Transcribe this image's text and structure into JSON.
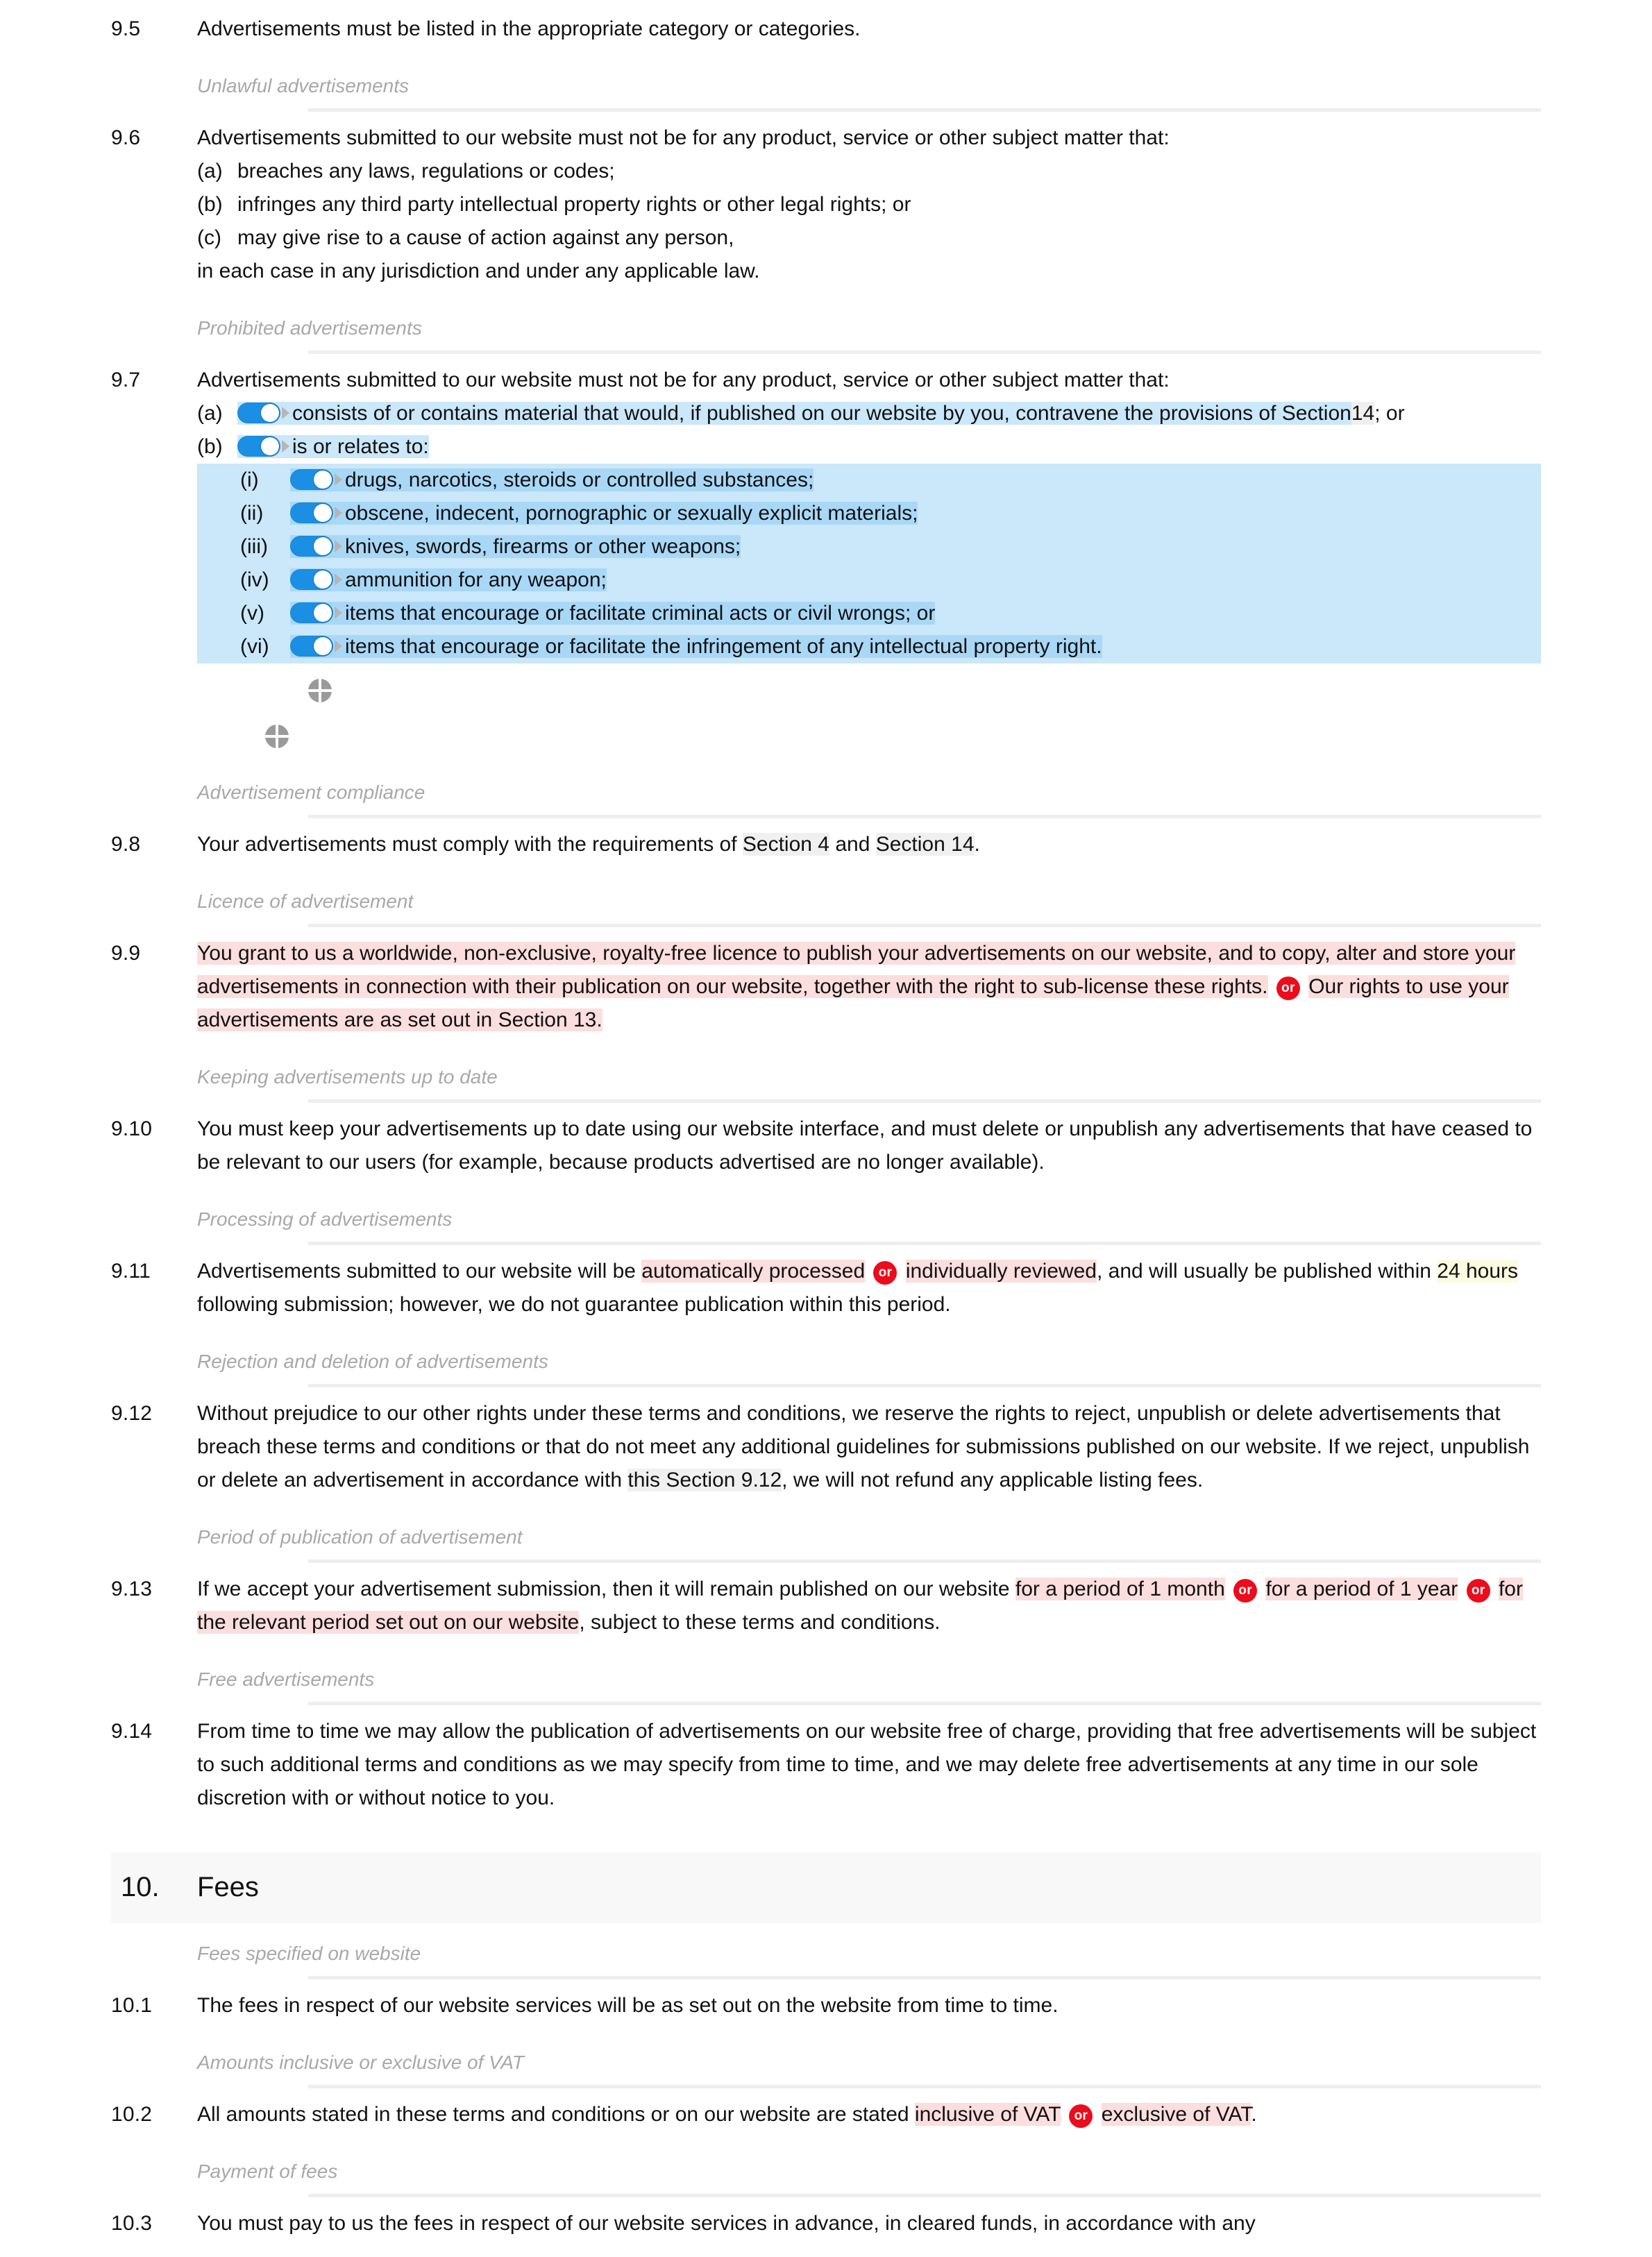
{
  "document": {
    "type": "terms-and-conditions-template-editor",
    "colors": {
      "toggle_on": "#1b8fe3",
      "or_badge": "#ec0c1b",
      "optional_highlight": "#fbdedd",
      "variable_highlight": "#fbfbe0",
      "crossref_highlight": "#f0f0f0",
      "selected_option_highlight": "#cbe7fa",
      "section_heading_band": "#f8f8f8",
      "subheading_text": "#a8a8a8"
    }
  },
  "clauses": [
    {
      "num": "9.5",
      "text": "Advertisements must be listed in the appropriate category or categories."
    }
  ],
  "subheads": {
    "unlawful": "Unlawful advertisements",
    "prohibited": "Prohibited advertisements",
    "compliance": "Advertisement compliance",
    "licence": "Licence of advertisement",
    "keeping": "Keeping advertisements up to date",
    "processing": "Processing of advertisements",
    "rejection": "Rejection and deletion of advertisements",
    "period": "Period of publication of advertisement",
    "free": "Free advertisements",
    "fees_specified": "Fees specified on website",
    "amounts_vat": "Amounts inclusive or exclusive of VAT",
    "payment": "Payment of fees"
  },
  "c96": {
    "num": "9.6",
    "lead": "Advertisements submitted to our website must not be for any product, service or other subject matter that:",
    "items": [
      {
        "marker": "(a)",
        "text": "breaches any laws, regulations or codes;"
      },
      {
        "marker": "(b)",
        "text": "infringes any third party intellectual property rights or other legal rights; or"
      },
      {
        "marker": "(c)",
        "text": "may give rise to a cause of action against any person,"
      }
    ],
    "tail": "in each case in any jurisdiction and under any applicable law."
  },
  "c97": {
    "num": "9.7",
    "lead": "Advertisements submitted to our website must not be for any product, service or other subject matter that:",
    "a": {
      "marker": "(a)",
      "text_1": "consists of or contains material that would, if published on our website by you, contravene the provisions of Section",
      "text_ref": "14",
      "text_2": "; or"
    },
    "b": {
      "marker": "(b)",
      "text": "is or relates to:",
      "items": [
        {
          "marker": "(i)",
          "text": "drugs, narcotics, steroids or controlled substances;"
        },
        {
          "marker": "(ii)",
          "text": "obscene, indecent, pornographic or sexually explicit materials;"
        },
        {
          "marker": "(iii)",
          "text": "knives, swords, firearms or other weapons;"
        },
        {
          "marker": "(iv)",
          "text": "ammunition for any weapon;"
        },
        {
          "marker": "(v)",
          "text": "items that encourage or facilitate criminal acts or civil wrongs; or"
        },
        {
          "marker": "(vi)",
          "text": "items that encourage or facilitate the infringement of any intellectual property right."
        }
      ]
    }
  },
  "c98": {
    "num": "9.8",
    "t1": "Your advertisements must comply with the requirements of ",
    "ref1": "Section 4",
    "t2": " and ",
    "ref2": "Section 14",
    "t3": "."
  },
  "c99": {
    "num": "9.9",
    "opt1": "You grant to us a worldwide, non-exclusive, royalty-free licence to publish your advertisements on our website, and to copy, alter and store your advertisements in connection with their publication on our website, together with the right to sub-license these rights.",
    "or": "or",
    "opt2_a": "Our rights to use your advertisements are as set out in ",
    "opt2_ref": "Section 13",
    "opt2_b": "."
  },
  "c910": {
    "num": "9.10",
    "text": "You must keep your advertisements up to date using our website interface, and must delete or unpublish any advertisements that have ceased to be relevant to our users (for example, because products advertised are no longer available)."
  },
  "c911": {
    "num": "9.11",
    "t1": "Advertisements submitted to our website will be ",
    "opt1": "automatically processed",
    "or": "or",
    "opt2": "individually reviewed",
    "t2": ", and will usually be published within ",
    "var": "24 hours",
    "t3": " following submission; however, we do not guarantee publication within this period."
  },
  "c912": {
    "num": "9.12",
    "t1": "Without prejudice to our other rights under these terms and conditions, we reserve the rights to reject, unpublish or delete advertisements that breach these terms and conditions or that do not meet any additional guidelines for submissions published on our website. If we reject, unpublish or delete an advertisement in accordance with ",
    "ref": "this Section 9.12",
    "t2": ", we will not refund any applicable listing fees."
  },
  "c913": {
    "num": "9.13",
    "t1": "If we accept your advertisement submission, then it will remain published on our website ",
    "opt1": "for a period of 1 month",
    "or1": "or",
    "opt2": "for a period of 1 year",
    "or2": "or",
    "opt3": "for the relevant period set out on our website",
    "t2": ", subject to these terms and conditions."
  },
  "c914": {
    "num": "9.14",
    "text": "From time to time we may allow the publication of advertisements on our website free of charge, providing that free advertisements will be subject to such additional terms and conditions as we may specify from time to time, and we may delete free advertisements at any time in our sole discretion with or without notice to you."
  },
  "section10": {
    "num": "10.",
    "title": "Fees"
  },
  "c101": {
    "num": "10.1",
    "text": "The fees in respect of our website services will be as set out on the website from time to time."
  },
  "c102": {
    "num": "10.2",
    "t1": "All amounts stated in these terms and conditions or on our website are stated ",
    "opt1": "inclusive of VAT",
    "or": "or",
    "opt2": "exclusive of VAT",
    "t2": "."
  },
  "c103": {
    "num": "10.3",
    "text": "You must pay to us the fees in respect of our website services in advance, in cleared funds, in accordance with any"
  },
  "icons": {
    "toggle": "toggle-switch-on",
    "caret": "caret-right-icon",
    "crosshair": "crosshair-move-icon"
  }
}
